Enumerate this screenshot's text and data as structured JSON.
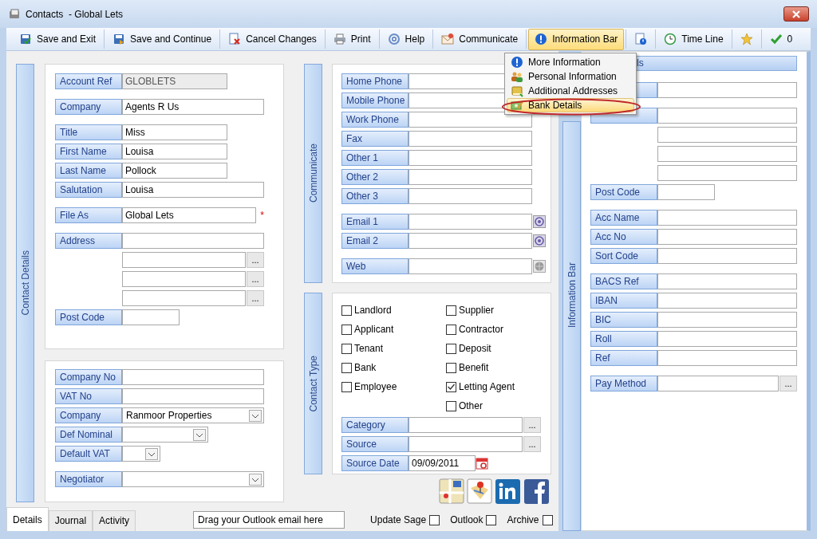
{
  "window": {
    "title": "Contacts  - Global Lets"
  },
  "toolbar": [
    {
      "label": "Save and Exit",
      "selected": false
    },
    {
      "label": "Save and Continue",
      "selected": false
    },
    {
      "label": "Cancel Changes",
      "selected": false
    },
    {
      "label": "Print",
      "selected": false
    },
    {
      "label": "Help",
      "selected": false
    },
    {
      "label": "Communicate",
      "selected": false
    },
    {
      "label": "Information Bar",
      "selected": true
    },
    {
      "selected": false
    },
    {
      "label": "Time Line",
      "selected": false
    },
    {
      "selected": false
    },
    {
      "label": "0",
      "selected": false
    }
  ],
  "info_menu": [
    {
      "label": "More Information",
      "selected": false
    },
    {
      "label": "Personal Information",
      "selected": false
    },
    {
      "label": "Additional Addresses",
      "selected": false
    },
    {
      "label": "Bank Details",
      "selected": true
    }
  ],
  "contact_details": {
    "tab": "Contact Details",
    "panels": [
      {
        "groups": [
          [
            {
              "label": "Account Ref",
              "value": "GLOBLETS",
              "kind": "readonly"
            }
          ],
          [
            {
              "label": "Company",
              "value": "Agents R Us",
              "kind": "text"
            }
          ],
          [
            {
              "label": "Title",
              "value": "Miss",
              "kind": "medium"
            },
            {
              "label": "First Name",
              "value": "Louisa",
              "kind": "medium"
            },
            {
              "label": "Last Name",
              "value": "Pollock",
              "kind": "medium"
            },
            {
              "label": "Salutation",
              "value": "Louisa",
              "kind": "text"
            }
          ],
          [
            {
              "label": "File As",
              "value": "Global Lets",
              "kind": "text",
              "required": "*"
            }
          ],
          [
            {
              "label": "Address",
              "kind": "text"
            },
            {
              "kind": "lookup",
              "button": "..."
            },
            {
              "kind": "lookup",
              "button": "..."
            },
            {
              "kind": "lookup",
              "button": "..."
            },
            {
              "label": "Post Code",
              "kind": "short"
            }
          ]
        ]
      },
      {
        "groups": [
          [
            {
              "label": "Company No",
              "kind": "text"
            },
            {
              "label": "VAT No",
              "kind": "text"
            },
            {
              "label": "Company",
              "value": "Ranmoor Properties",
              "kind": "select"
            },
            {
              "label": "Def Nominal",
              "kind": "selectmid"
            },
            {
              "label": "Default VAT",
              "kind": "selectsmall"
            }
          ],
          [
            {
              "label": "Negotiator",
              "kind": "select"
            }
          ]
        ]
      }
    ]
  },
  "communicate": {
    "tab": "Communicate",
    "groups": [
      [
        {
          "label": "Home Phone",
          "kind": "text"
        },
        {
          "label": "Mobile Phone",
          "kind": "text"
        },
        {
          "label": "Work Phone",
          "kind": "text"
        },
        {
          "label": "Fax",
          "kind": "text"
        },
        {
          "label": "Other 1",
          "kind": "text"
        },
        {
          "label": "Other 2",
          "kind": "text"
        },
        {
          "label": "Other 3",
          "kind": "text"
        }
      ],
      [
        {
          "label": "Email 1",
          "kind": "email"
        },
        {
          "label": "Email 2",
          "kind": "email"
        }
      ],
      [
        {
          "label": "Web",
          "kind": "web"
        }
      ]
    ]
  },
  "contact_type": {
    "tab": "Contact Type",
    "columns": [
      [
        {
          "label": "Landlord",
          "checked": false
        },
        {
          "label": "Applicant",
          "checked": false
        },
        {
          "label": "Tenant",
          "checked": false
        },
        {
          "label": "Bank",
          "checked": false
        },
        {
          "label": "Employee",
          "checked": false
        }
      ],
      [
        {
          "label": "Supplier",
          "checked": false
        },
        {
          "label": "Contractor",
          "checked": false
        },
        {
          "label": "Deposit",
          "checked": false
        },
        {
          "label": "Benefit",
          "checked": false
        },
        {
          "label": "Letting Agent",
          "checked": true
        },
        {
          "label": "Other",
          "checked": false
        }
      ]
    ],
    "rows": [
      {
        "label": "Category",
        "kind": "lookup",
        "button": "..."
      },
      {
        "label": "Source",
        "kind": "lookup",
        "button": "..."
      },
      {
        "label": "Source Date",
        "value": "09/09/2011",
        "kind": "date"
      }
    ]
  },
  "information_bar": {
    "tab": "Information Bar",
    "header": "ls",
    "groups": [
      [
        {
          "kind": "covered"
        }
      ],
      [
        {
          "kind": "covered"
        },
        {
          "kind": "text"
        },
        {
          "kind": "text"
        },
        {
          "kind": "text"
        },
        {
          "label": "Post Code",
          "kind": "short"
        }
      ],
      [
        {
          "label": "Acc Name",
          "kind": "text"
        },
        {
          "label": "Acc No",
          "kind": "text"
        },
        {
          "label": "Sort Code",
          "kind": "text"
        }
      ],
      [
        {
          "label": "BACS Ref",
          "kind": "text"
        },
        {
          "label": "IBAN",
          "kind": "text"
        },
        {
          "label": "BIC",
          "kind": "text"
        },
        {
          "label": "Roll",
          "kind": "text"
        },
        {
          "label": "Ref",
          "kind": "text"
        }
      ],
      [
        {
          "label": "Pay Method",
          "kind": "lookup",
          "button": "..."
        }
      ]
    ]
  },
  "footer": {
    "tabs": [
      {
        "label": "Details",
        "selected": true
      },
      {
        "label": "Journal",
        "selected": false
      },
      {
        "label": "Activity",
        "selected": false
      }
    ],
    "drop_zone": "Drag your Outlook email here",
    "options": [
      {
        "label": "Update Sage",
        "checked": false
      },
      {
        "label": "Outlook",
        "checked": false
      },
      {
        "label": "Archive",
        "checked": false
      }
    ]
  }
}
